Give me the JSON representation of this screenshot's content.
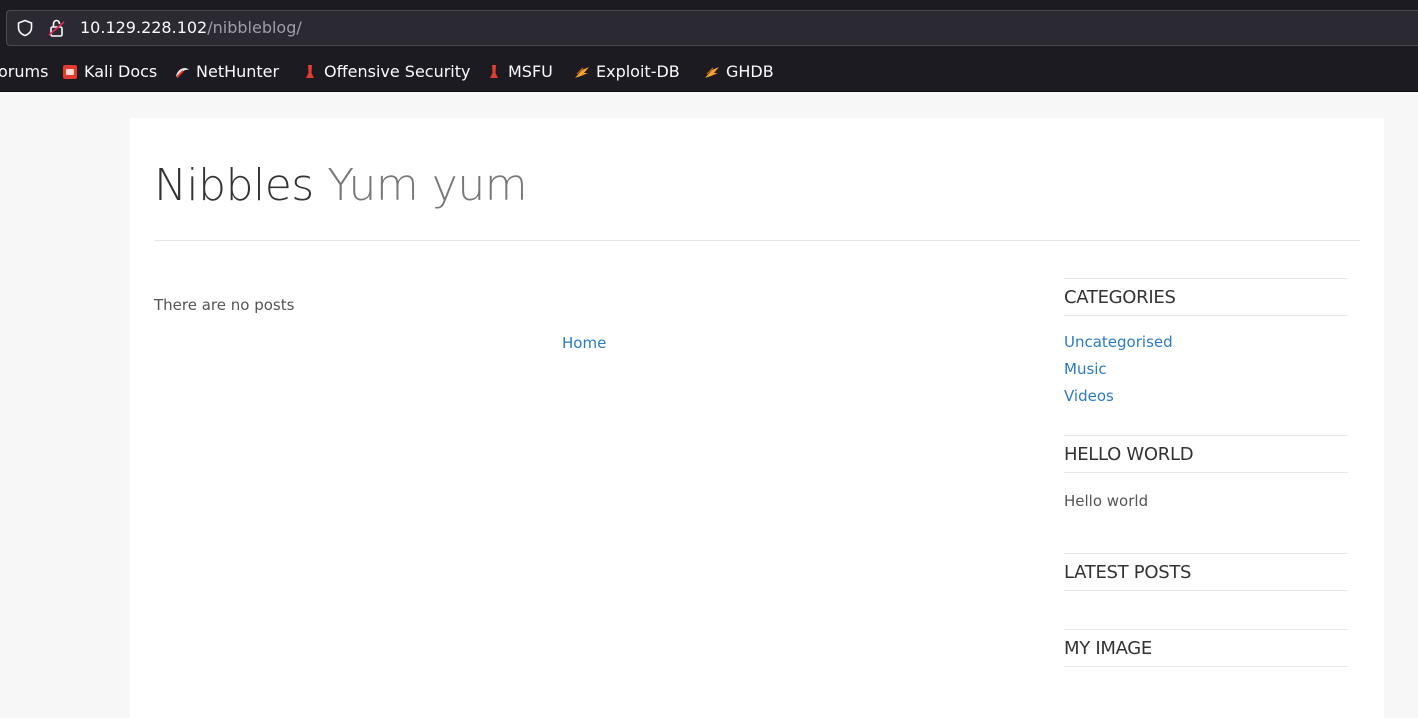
{
  "browser": {
    "url_host": "10.129.228.102",
    "url_path": "/nibbleblog/",
    "bookmarks": [
      {
        "label": "orums",
        "icon": "none"
      },
      {
        "label": "Kali Docs",
        "icon": "kali-docs-icon"
      },
      {
        "label": "NetHunter",
        "icon": "nethunter-icon"
      },
      {
        "label": "Offensive Security",
        "icon": "offsec-icon"
      },
      {
        "label": "MSFU",
        "icon": "offsec-icon"
      },
      {
        "label": "Exploit-DB",
        "icon": "exploit-db-icon"
      },
      {
        "label": "GHDB",
        "icon": "exploit-db-icon"
      }
    ]
  },
  "site": {
    "title": "Nibbles",
    "slogan": "Yum yum",
    "no_posts_text": "There are no posts",
    "home_link": "Home"
  },
  "sidebar": {
    "categories_title": "CATEGORIES",
    "categories": [
      "Uncategorised",
      "Music",
      "Videos"
    ],
    "hello_title": "HELLO WORLD",
    "hello_text": "Hello world",
    "latest_title": "LATEST POSTS",
    "image_title": "MY IMAGE"
  },
  "colors": {
    "link": "#2a7bc4",
    "chrome_bg": "#1c1b22",
    "page_bg": "#f7f7f7"
  }
}
